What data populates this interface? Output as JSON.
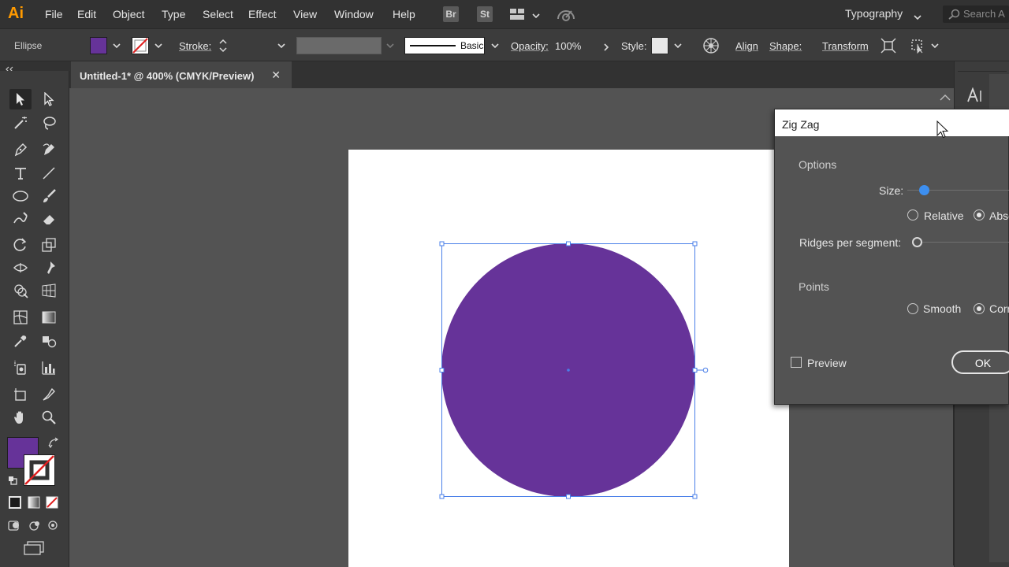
{
  "app": {
    "logo": "Ai",
    "menu": [
      "File",
      "Edit",
      "Object",
      "Type",
      "Select",
      "Effect",
      "View",
      "Window",
      "Help"
    ],
    "bridge_label": "Br",
    "stock_label": "St",
    "workspace": "Typography",
    "search_placeholder": "Search A"
  },
  "control_bar": {
    "selection_type": "Ellipse",
    "fill_color": "#663399",
    "stroke_label": "Stroke:",
    "brush_label": "Basic",
    "opacity_label": "Opacity:",
    "opacity_value": "100%",
    "style_label": "Style:",
    "align_label": "Align",
    "shape_label": "Shape:",
    "transform_label": "Transform"
  },
  "document": {
    "tab_title": "Untitled-1* @ 400% (CMYK/Preview)",
    "close_glyph": "✕",
    "shape_fill": "#663399",
    "selection_color": "#4a7fe8"
  },
  "tools": {
    "fill_swatch": "#663399"
  },
  "dialog": {
    "title": "Zig Zag",
    "options_heading": "Options",
    "size_label": "Size:",
    "size_fraction": 0.0,
    "relative_label": "Relative",
    "absolute_label": "Abso",
    "mode_selected": "absolute",
    "ridges_label": "Ridges per segment:",
    "ridges_fraction": 0.0,
    "points_heading": "Points",
    "smooth_label": "Smooth",
    "corner_label": "Corn",
    "points_selected": "corner",
    "preview_label": "Preview",
    "preview_checked": false,
    "ok_label": "OK",
    "accent_color": "#3d8ff0"
  }
}
